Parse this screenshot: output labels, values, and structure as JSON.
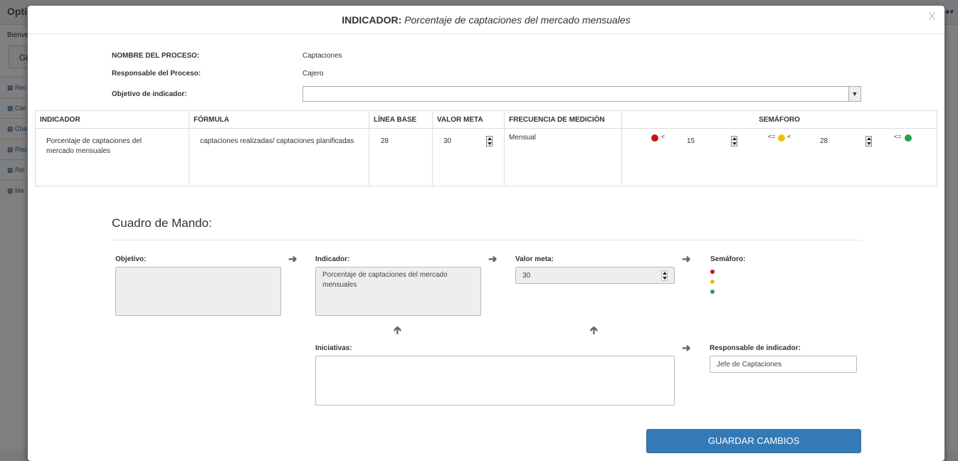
{
  "background": {
    "brand": "Opti",
    "welcome": "Bienve",
    "button_label": "Gi",
    "side_items": [
      "Rec",
      "Clie",
      "Cha",
      "Rep",
      "Rel",
      "Ma"
    ]
  },
  "modal": {
    "title_prefix": "INDICADOR:",
    "title_name": "Porcentaje de captaciones del mercado mensuales",
    "close_label": "X"
  },
  "process": {
    "name_label": "NOMBRE DEL PROCESO:",
    "name_value": "Captaciones",
    "responsible_label": "Responsable del Proceso:",
    "responsible_value": "Cajero",
    "objective_label": "Objetivo de indicador:",
    "objective_value": ""
  },
  "table": {
    "headers": [
      "INDICADOR",
      "FÓRMULA",
      "LÍNEA BASE",
      "VALOR META",
      "FRECUENCIA DE MEDICIÓN",
      "SEMÁFORO"
    ],
    "row": {
      "indicador": "Porcentaje de captaciones del mercado mensuales",
      "formula": "captaciones realizadas/ captaciones planificadas",
      "linea_base": "28",
      "valor_meta": "30",
      "frecuencia": "Mensual",
      "semaforo": {
        "red_op": "<",
        "red_value": "15",
        "yellow_op_left": "<=",
        "yellow_op_right": "<",
        "yellow_value": "28",
        "green_op": "<="
      }
    }
  },
  "colors": {
    "red": "#cc1111",
    "yellow": "#f0c000",
    "green": "#22a04a",
    "primary": "#337ab7"
  },
  "cuadro": {
    "title": "Cuadro de Mando:",
    "objetivo_label": "Objetivo:",
    "objetivo_value": "",
    "indicador_label": "Indicador:",
    "indicador_value": "Porcentaje de captaciones del mercado mensuales",
    "valor_meta_label": "Valor meta:",
    "valor_meta_value": "30",
    "semaforo_label": "Semáforo:",
    "iniciativas_label": "Iniciativas:",
    "iniciativas_value": "",
    "responsable_label": "Responsable de indicador:",
    "responsable_value": "Jefe de Captaciones"
  },
  "actions": {
    "save_label": "GUARDAR CAMBIOS"
  }
}
